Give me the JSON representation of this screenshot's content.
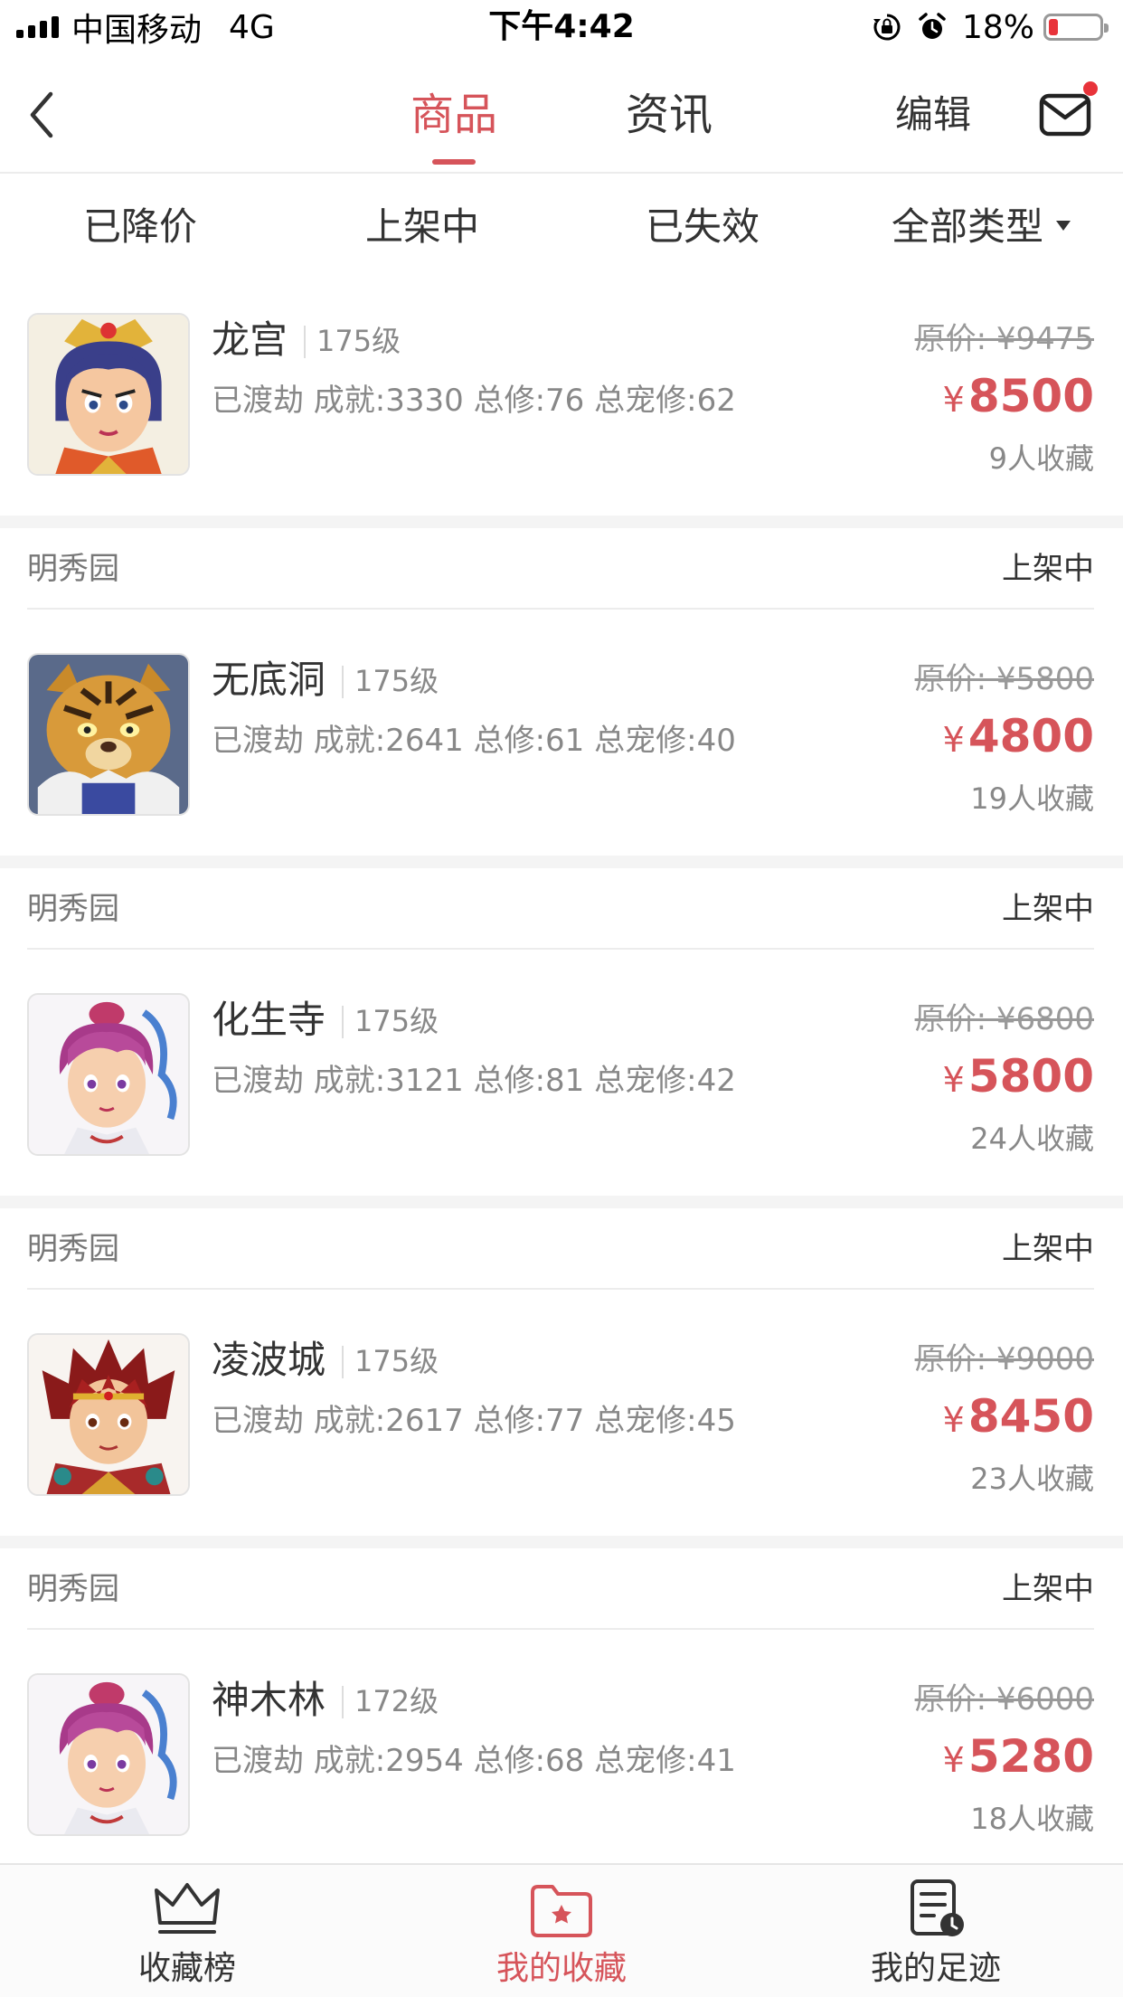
{
  "status_bar": {
    "carrier": "中国移动",
    "network": "4G",
    "time": "下午4:42",
    "battery_percent": "18%",
    "battery_level": 0.18
  },
  "nav": {
    "back_icon": "chevron-left-icon",
    "tabs": [
      {
        "label": "商品",
        "active": true
      },
      {
        "label": "资讯",
        "active": false
      }
    ],
    "edit_label": "编辑",
    "mail_icon": "mail-icon",
    "has_unread": true
  },
  "filters": [
    {
      "label": "已降价"
    },
    {
      "label": "上架中"
    },
    {
      "label": "已失效"
    },
    {
      "label": "全部类型",
      "dropdown": true
    }
  ],
  "items": [
    {
      "server": "",
      "status": "",
      "school": "龙宫",
      "level": "175级",
      "stats": "已渡劫 成就:3330 总修:76 总宠修:62",
      "original_price": "原价: ¥9475",
      "price_symbol": "¥",
      "price": "8500",
      "favorites": "9人收藏",
      "avatar": "dragon-palace-avatar"
    },
    {
      "server": "明秀园",
      "status": "上架中",
      "school": "无底洞",
      "level": "175级",
      "stats": "已渡劫 成就:2641 总修:61 总宠修:40",
      "original_price": "原价: ¥5800",
      "price_symbol": "¥",
      "price": "4800",
      "favorites": "19人收藏",
      "avatar": "tiger-avatar"
    },
    {
      "server": "明秀园",
      "status": "上架中",
      "school": "化生寺",
      "level": "175级",
      "stats": "已渡劫 成就:3121 总修:81 总宠修:42",
      "original_price": "原价: ¥6800",
      "price_symbol": "¥",
      "price": "5800",
      "favorites": "24人收藏",
      "avatar": "purple-hair-avatar"
    },
    {
      "server": "明秀园",
      "status": "上架中",
      "school": "凌波城",
      "level": "175级",
      "stats": "已渡劫 成就:2617 总修:77 总宠修:45",
      "original_price": "原价: ¥9000",
      "price_symbol": "¥",
      "price": "8450",
      "favorites": "23人收藏",
      "avatar": "red-hair-avatar"
    },
    {
      "server": "明秀园",
      "status": "上架中",
      "school": "神木林",
      "level": "172级",
      "stats": "已渡劫 成就:2954 总修:68 总宠修:41",
      "original_price": "原价: ¥6000",
      "price_symbol": "¥",
      "price": "5280",
      "favorites": "18人收藏",
      "avatar": "purple-hair-avatar"
    }
  ],
  "tab_bar": [
    {
      "label": "收藏榜",
      "icon": "crown-icon",
      "active": false
    },
    {
      "label": "我的收藏",
      "icon": "star-folder-icon",
      "active": true
    },
    {
      "label": "我的足迹",
      "icon": "history-document-icon",
      "active": false
    }
  ],
  "colors": {
    "accent": "#d6545a",
    "divider": "#ececec",
    "gap_background": "#f4f4f4"
  }
}
